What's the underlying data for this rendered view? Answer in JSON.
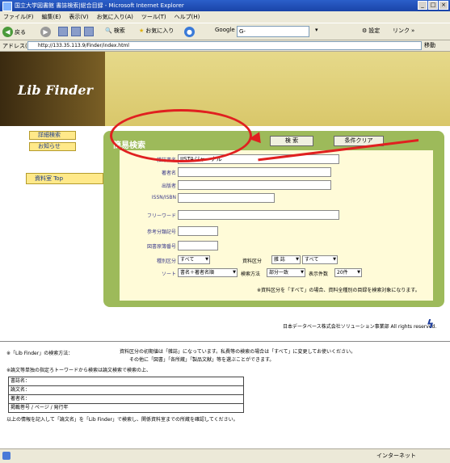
{
  "window": {
    "title": "国立大学図書館 書誌検索|総合目録 - Microsoft Internet Explorer",
    "controls": [
      "_",
      "□",
      "×"
    ]
  },
  "menu": [
    "ファイル(F)",
    "編集(E)",
    "表示(V)",
    "お気に入り(A)",
    "ツール(T)",
    "ヘルプ(H)"
  ],
  "toolbar": {
    "back": "戻る",
    "search": "検索",
    "favorites": "お気に入り",
    "google_label": "Google",
    "google_value": "G-",
    "settings": "設定",
    "links": "リンク"
  },
  "address": {
    "label": "アドレス(D)",
    "url": "http://133.35.113.9/Finder/index.html",
    "go": "移動"
  },
  "banner": {
    "logo": "Lib Finder"
  },
  "side": {
    "detail": "詳細検索",
    "notice": "お知らせ",
    "top": "資料室 Top"
  },
  "panel": {
    "title": "簡易検索",
    "search_button": "検 索",
    "clear_button": "条件クリア",
    "fields": [
      {
        "label": "雑誌書名",
        "value": "JISTAジャーナル"
      },
      {
        "label": "著者名",
        "value": ""
      },
      {
        "label": "出版者",
        "value": ""
      },
      {
        "label": "ISSN/ISBN",
        "value": ""
      },
      {
        "label": "フリーワード",
        "value": ""
      },
      {
        "label": "参考分類記号",
        "value": ""
      },
      {
        "label": "図書原簿番号",
        "value": ""
      }
    ],
    "row_type_label": "種別区分",
    "row_type_value": "すべて",
    "row_cat_label": "資料区分",
    "row_cat_value1": "雑 誌",
    "row_cat_value2": "すべて",
    "sort_label": "ソート",
    "sort_value": "書名＋著者名順",
    "match_label": "検索方法",
    "match_value": "部分一致",
    "count_label": "表示件数",
    "count_value": "20件",
    "note": "※資料区分を「すべて」の場合、資料全種別の目録を検索対象になります。"
  },
  "footer_copyright": "日本データベース株式会社ソリューション事業部 All rights reserved.",
  "bottom": {
    "line1_label": "※「Lib Finder」の検索方法：",
    "line1_text": "資料区分の初期値は「雑誌」になっています。私費等の検索の場合は「すべて」に変更してお使いください。",
    "line2_text": "その他に「図書」「各所蔵」「製品文献」等を選ぶことができます。",
    "line3": "※論文等単独の指定ろトーワードから検索は論文検索で検索の上、",
    "form_rows": [
      "書誌名：",
      "論文名：",
      "著者名：",
      "掲載巻号 / ページ / 発行年"
    ],
    "line4": "以上の情報を記入して「論文名」を「Lib Finder」で検索し、関係資料室までの所蔵を確認してください。"
  },
  "status": {
    "zone": "インターネット"
  },
  "colors": {
    "callout": "#e02020",
    "panel": "#9dba5a",
    "banner": "#b89a3a"
  }
}
